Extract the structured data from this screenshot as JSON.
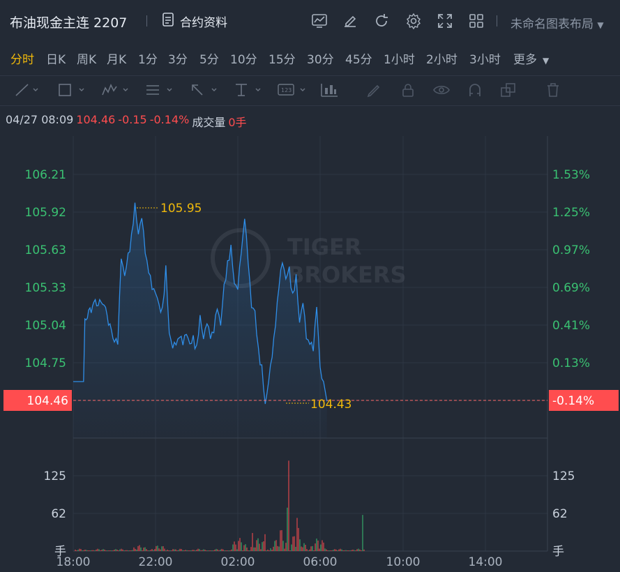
{
  "header": {
    "title": "布油现金主连 2207",
    "contract_info": "合约资料",
    "layout_label": "未命名图表布局"
  },
  "periods": [
    "分时",
    "日K",
    "周K",
    "月K",
    "1分",
    "3分",
    "5分",
    "10分",
    "15分",
    "30分",
    "45分",
    "1小时",
    "2小时",
    "3小时",
    "更多"
  ],
  "active_period": "分时",
  "quote": {
    "datetime": "04/27 08:09",
    "price": "104.46",
    "change": "-0.15",
    "change_pct": "-0.14%",
    "volume_label": "成交量",
    "volume_value": "0手"
  },
  "colors": {
    "accent": "#f0b90b",
    "down": "#ff4d4f",
    "up": "#3ac172",
    "line": "#2f8ee8"
  },
  "chart_data": {
    "type": "line",
    "y_ticks_left": [
      "106.21",
      "105.92",
      "105.63",
      "105.33",
      "105.04",
      "104.75"
    ],
    "y_ticks_right": [
      "1.53%",
      "1.25%",
      "0.97%",
      "0.69%",
      "0.41%",
      "0.13%"
    ],
    "current_price_label": "104.46",
    "current_pct_label": "-0.14%",
    "high_label": "105.95",
    "low_label": "104.43",
    "x_ticks": [
      "18:00",
      "22:00",
      "02:00",
      "06:00",
      "10:00",
      "14:00"
    ],
    "volume_ticks_left": [
      "125",
      "62",
      "手"
    ],
    "volume_ticks_right": [
      "125",
      "62",
      "手"
    ],
    "ylim": [
      104.18,
      106.48
    ],
    "reference_price": 104.61,
    "x": [
      "18:00",
      "18:30",
      "18:34",
      "18:45",
      "19:00",
      "19:30",
      "20:00",
      "20:10",
      "20:20",
      "20:30",
      "20:40",
      "20:50",
      "21:00",
      "21:10",
      "21:20",
      "21:30",
      "21:40",
      "21:50",
      "22:00",
      "22:10",
      "22:20",
      "22:30",
      "22:40",
      "22:50",
      "23:00",
      "23:10",
      "23:20",
      "23:30",
      "23:40",
      "23:50",
      "00:00",
      "00:10",
      "00:20",
      "00:30",
      "00:40",
      "00:50",
      "01:00",
      "01:10",
      "01:20",
      "01:30",
      "01:40",
      "01:50",
      "02:00",
      "02:10",
      "02:20",
      "02:30",
      "02:40",
      "02:50",
      "03:00",
      "03:10",
      "03:20",
      "03:30",
      "03:40",
      "03:50",
      "04:00",
      "04:10",
      "04:20",
      "04:30",
      "04:40",
      "04:50",
      "05:00",
      "05:10",
      "05:20",
      "05:30",
      "05:40",
      "05:50",
      "06:00",
      "06:10",
      "06:20",
      "06:30",
      "06:40",
      "06:50",
      "07:00",
      "07:10",
      "07:20",
      "07:30",
      "07:40",
      "07:50",
      "08:00",
      "08:05",
      "08:09"
    ],
    "values": [
      104.61,
      104.61,
      105.05,
      105.15,
      105.2,
      105.2,
      104.92,
      104.92,
      105.58,
      105.42,
      105.58,
      105.7,
      105.95,
      105.72,
      105.85,
      105.6,
      105.45,
      105.35,
      105.3,
      105.2,
      105.15,
      105.46,
      104.98,
      104.85,
      104.9,
      104.95,
      104.92,
      105.0,
      104.9,
      104.95,
      104.85,
      105.1,
      104.92,
      105.05,
      104.95,
      105.0,
      105.2,
      105.05,
      105.35,
      105.5,
      105.62,
      105.35,
      105.3,
      105.6,
      105.85,
      105.55,
      105.2,
      105.15,
      104.85,
      104.7,
      104.43,
      104.6,
      104.8,
      105.05,
      105.35,
      105.55,
      105.4,
      105.48,
      105.25,
      105.4,
      105.05,
      105.2,
      104.95,
      104.9,
      104.88,
      105.2,
      104.72,
      104.61,
      104.46
    ],
    "volume_note": ""
  }
}
